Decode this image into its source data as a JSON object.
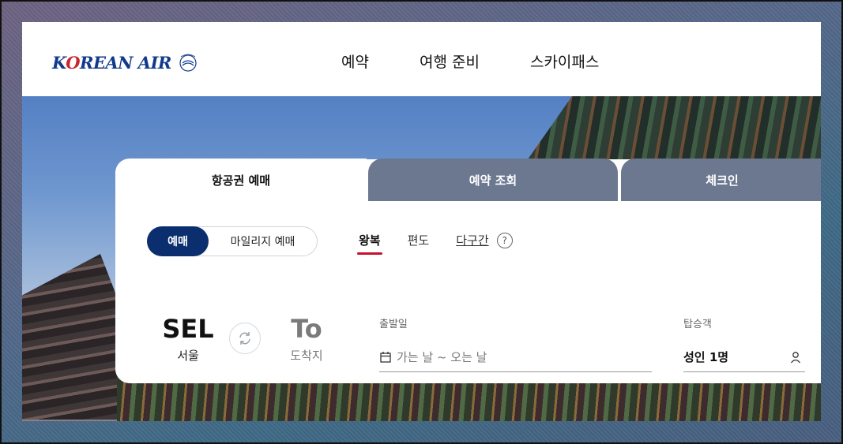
{
  "logo": {
    "text_pre": "K",
    "text_o": "O",
    "text_post": "REAN AIR"
  },
  "nav": {
    "items": [
      "예약",
      "여행 준비",
      "스카이패스"
    ]
  },
  "tabs": {
    "book": "항공권 예매",
    "lookup": "예약 조회",
    "checkin": "체크인"
  },
  "booking_type": {
    "selected": "예매",
    "other": "마일리지 예매"
  },
  "trip_type": {
    "round": "왕복",
    "oneway": "편도",
    "multi": "다구간",
    "help": "?"
  },
  "origin": {
    "code": "SEL",
    "city": "서울"
  },
  "destination": {
    "code": "To",
    "city": "도착지"
  },
  "date": {
    "label": "출발일",
    "placeholder": "가는 날 ~ 오는 날"
  },
  "passengers": {
    "label": "탑승객",
    "value": "성인 1명"
  },
  "colors": {
    "brand": "#0b2f6e",
    "accent": "#c8102e",
    "inactive_tab": "#6c7890"
  }
}
